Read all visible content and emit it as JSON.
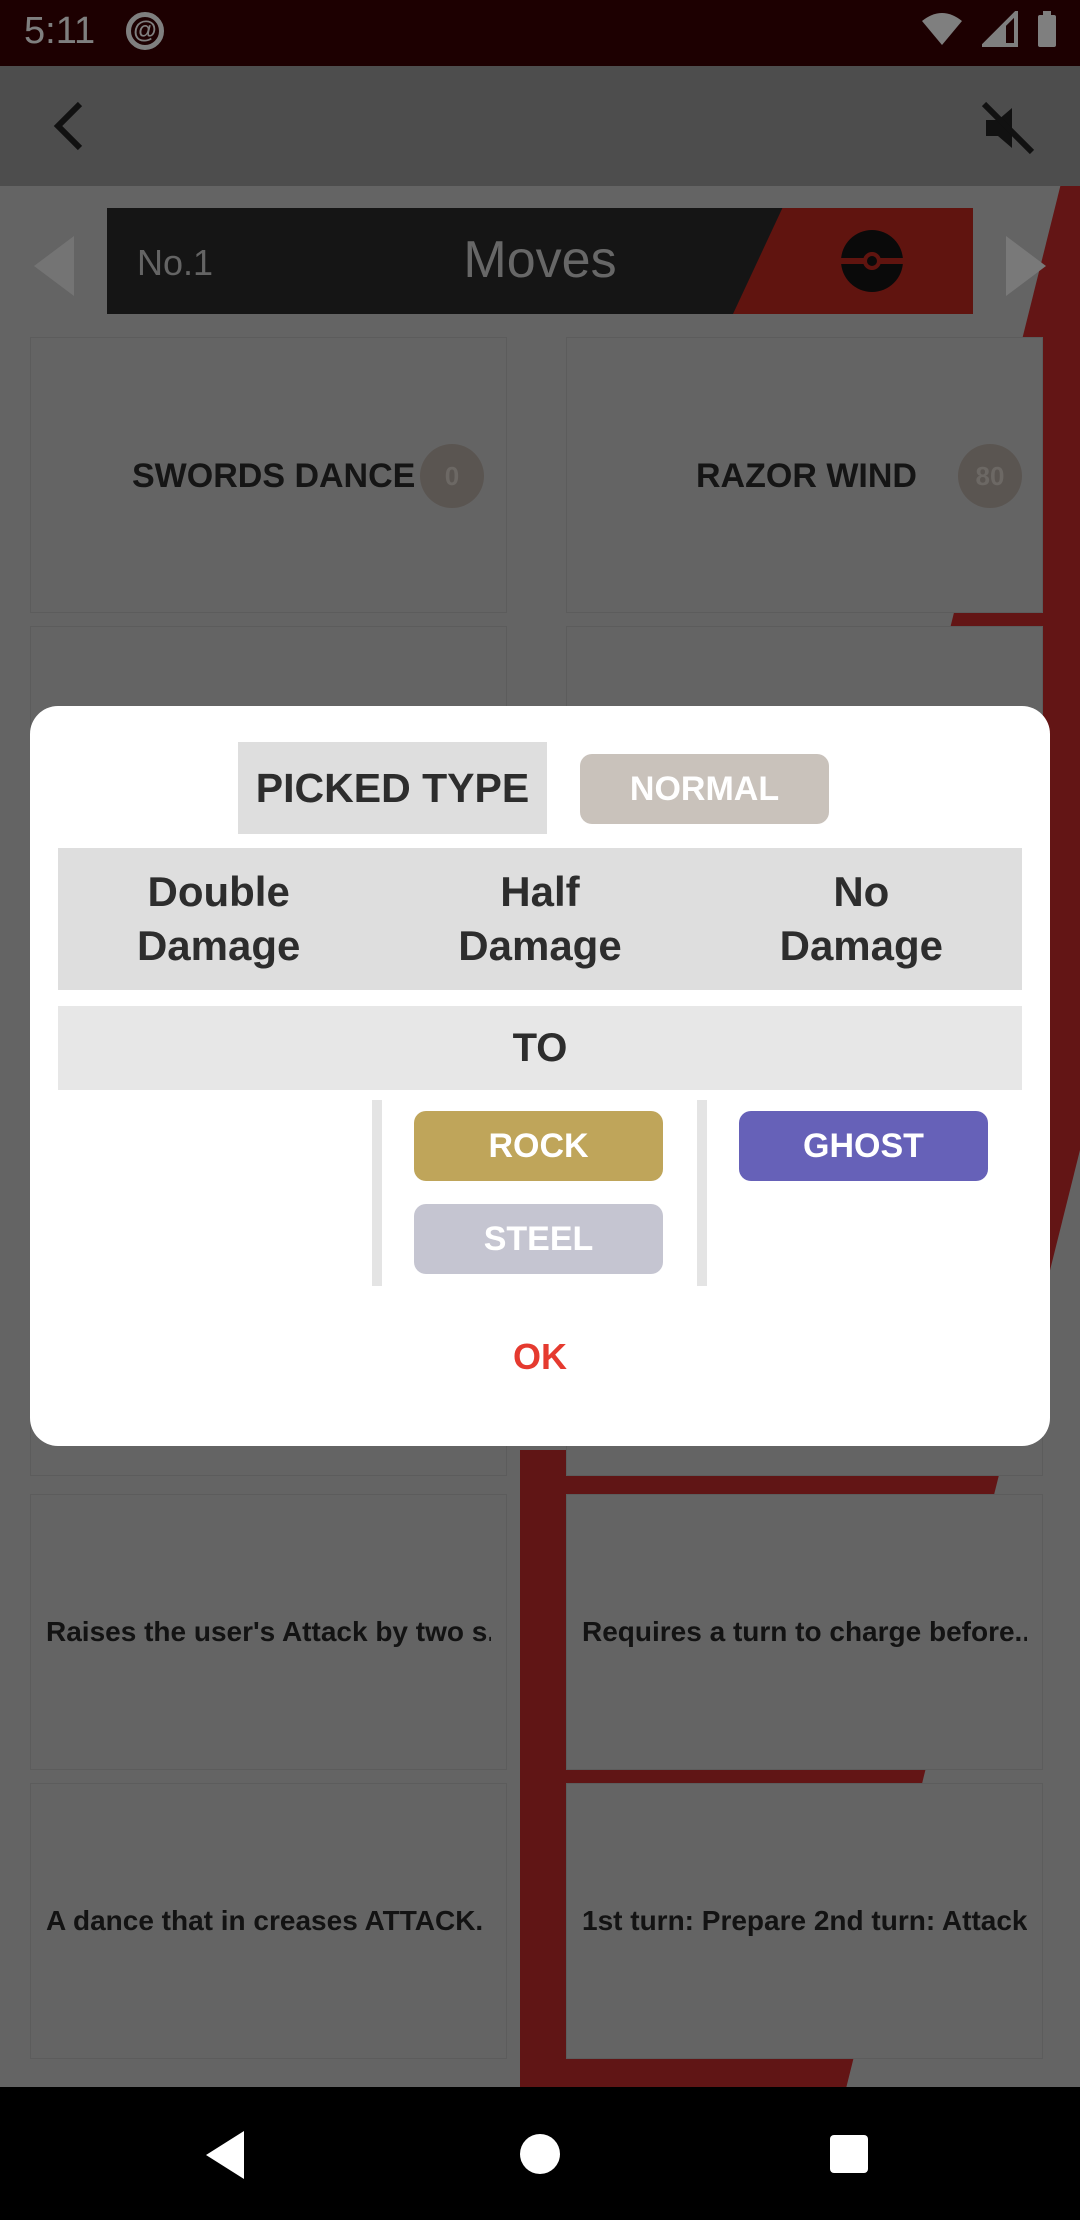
{
  "status_bar": {
    "time": "5:11"
  },
  "header": {
    "number": "No.1",
    "title": "Moves"
  },
  "moves": [
    {
      "name": "SWORDS DANCE",
      "power": "0"
    },
    {
      "name": "RAZOR WIND",
      "power": "80"
    }
  ],
  "descriptions": [
    "Raises the user's Attack by two s...",
    "Requires a turn to charge before...",
    "A dance that in creases ATTACK.",
    "1st turn: Prepare 2nd turn: Attack"
  ],
  "dialog": {
    "picked_label": "PICKED TYPE",
    "picked_type": "NORMAL",
    "columns": {
      "double_line1": "Double",
      "double_line2": "Damage",
      "half_line1": "Half",
      "half_line2": "Damage",
      "none_line1": "No",
      "none_line2": "Damage"
    },
    "to_label": "TO",
    "half_types": [
      "ROCK",
      "STEEL"
    ],
    "no_types": [
      "GHOST"
    ],
    "ok_label": "OK"
  },
  "colors": {
    "normal": "#c9c2bb",
    "rock": "#bfa55a",
    "steel": "#c5c5d1",
    "ghost": "#6661b8",
    "ok": "#e53a2f",
    "accent_red": "#c0281f"
  },
  "icons": [
    "back-arrow-icon",
    "mute-icon",
    "pokeball-icon",
    "prev-arrow-icon",
    "next-arrow-icon"
  ]
}
